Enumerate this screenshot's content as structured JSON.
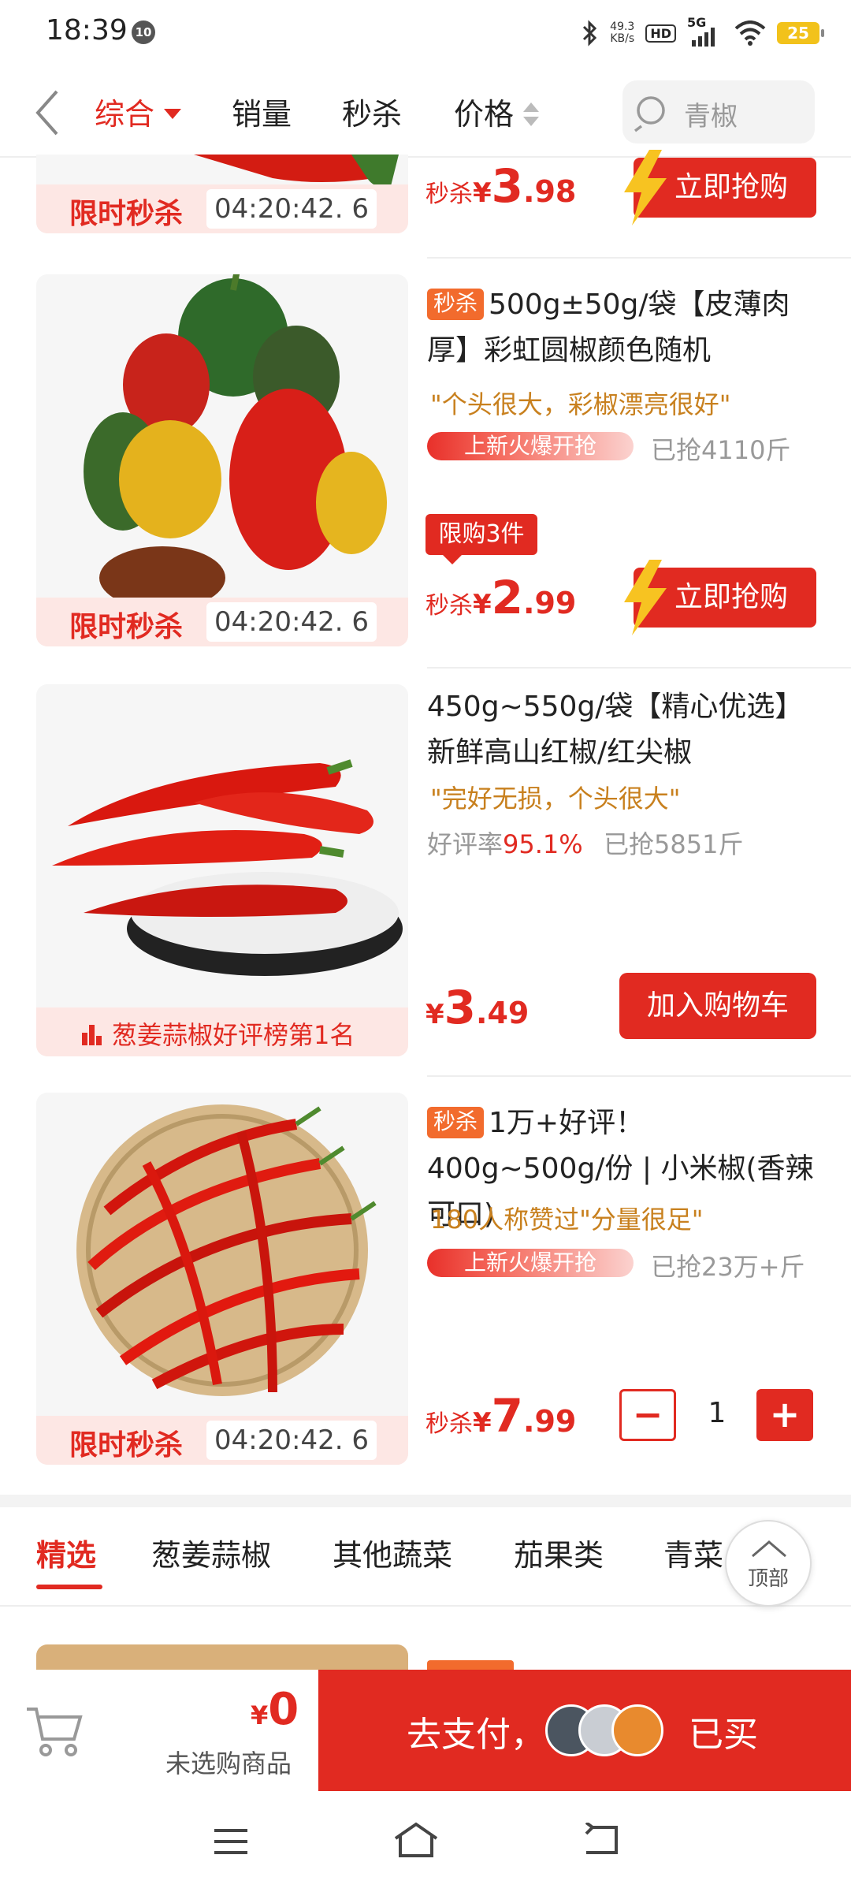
{
  "status_bar": {
    "time": "18:39",
    "notif_badge": "10",
    "net_speed": "49.3",
    "net_unit": "KB/s",
    "hd": "HD",
    "signal": "5G",
    "battery": "25"
  },
  "topnav": {
    "tabs": [
      {
        "label": "综合"
      },
      {
        "label": "销量"
      },
      {
        "label": "秒杀"
      },
      {
        "label": "价格"
      }
    ],
    "search_placeholder": "青椒"
  },
  "products": [
    {
      "flash_label": "限时秒杀",
      "countdown": "04:20:42. 6",
      "price_prefix": "秒杀",
      "price_int": "3",
      "price_dec": ".98",
      "buy_label": "立即抢购"
    },
    {
      "tag": "秒杀",
      "title": "500g±50g/袋【皮薄肉厚】彩虹圆椒颜色随机",
      "quote": "\"个头很大，彩椒漂亮很好\"",
      "hot_label": "上新火爆开抢",
      "sold": "已抢4110斤",
      "limit": "限购3件",
      "flash_label": "限时秒杀",
      "countdown": "04:20:42. 6",
      "price_prefix": "秒杀",
      "price_int": "2",
      "price_dec": ".99",
      "buy_label": "立即抢购"
    },
    {
      "title": "450g~550g/袋【精心优选】新鲜高山红椒/红尖椒",
      "quote": "\"完好无损，个头很大\"",
      "rating_label": "好评率",
      "rating_pct": "95.1%",
      "sold": "已抢5851斤",
      "rank_text": "葱姜蒜椒好评榜第1名",
      "price_int": "3",
      "price_dec": ".49",
      "cart_label": "加入购物车"
    },
    {
      "tag": "秒杀",
      "title": "1万+好评！400g~500g/份 | 小米椒(香辣可口)",
      "quote": "180人称赞过\"分量很足\"",
      "hot_label": "上新火爆开抢",
      "sold": "已抢23万+斤",
      "flash_label": "限时秒杀",
      "countdown": "04:20:42. 6",
      "price_prefix": "秒杀",
      "price_int": "7",
      "price_dec": ".99",
      "qty": "1"
    }
  ],
  "yen": "¥",
  "categories": [
    "精选",
    "葱姜蒜椒",
    "其他蔬菜",
    "茄果类",
    "青菜"
  ],
  "back_top_label": "顶部",
  "bottom": {
    "total_yen": "¥",
    "total": "0",
    "none_label": "未选购商品",
    "pay_label": "去支付，",
    "bought_label": "已买"
  },
  "colors": {
    "accent": "#e12a21",
    "quote": "#c8801e",
    "seckill_tag": "#f26b2d"
  }
}
